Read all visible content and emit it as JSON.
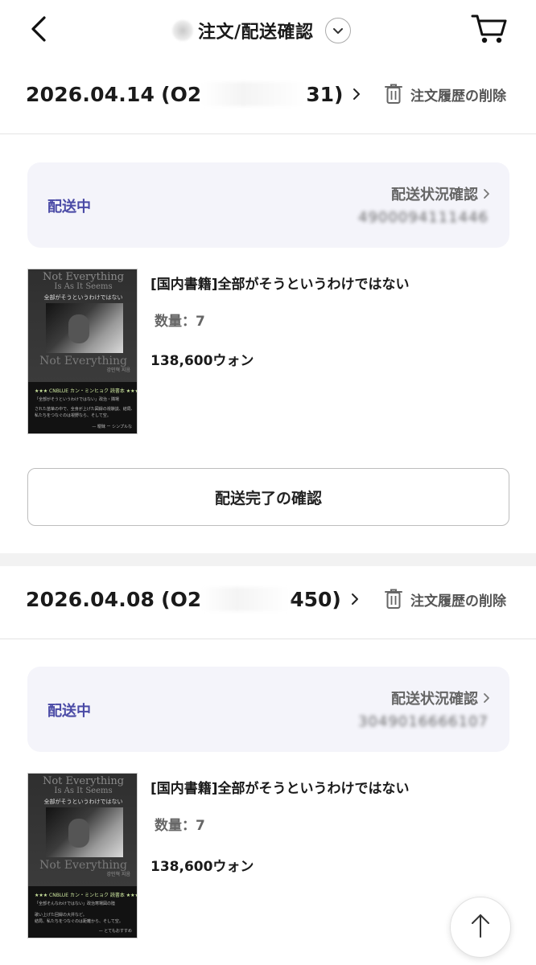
{
  "header": {
    "title": "注文/配送確認",
    "back_icon": "chevron-left-icon",
    "dropdown_icon": "chevron-down-icon",
    "cart_icon": "cart-icon"
  },
  "orders": [
    {
      "date": "2026.04.14",
      "order_no_prefix": "(O2",
      "order_no_suffix": "31)",
      "delete_label": "注文履歴の削除",
      "status": "配送中",
      "track_label": "配送状況確認",
      "tracking_no": "4900094111446",
      "product": {
        "name": "[国内書籍]全部がそうというわけではない",
        "qty": "数量：7",
        "price": "138,600ウォン",
        "cover": {
          "title_en": "Not Everything",
          "subtitle_en": "Is As It Seems",
          "title_jp": "全部がそうというわけではない",
          "author": "강민혁 지음",
          "stars": "★★★ CNBLUE カン・ミンヒョク 読書本 ★★★",
          "line1": "「全部がそうというわけではない」政治・隣場",
          "line2": "された苗箪の中で、全身が上げた図録の視験説、結局、",
          "line3": "私たちをつなぐのは視野なら、そして空。",
          "line4": "— 曖昧 ー シンプルな",
          "line5": ""
        }
      },
      "confirm_label": "配送完了の確認"
    },
    {
      "date": "2026.04.08",
      "order_no_prefix": "(O2",
      "order_no_suffix": "450)",
      "delete_label": "注文履歴の削除",
      "status": "配送中",
      "track_label": "配送状況確認",
      "tracking_no": "3049016666107",
      "product": {
        "name": "[国内書籍]全部がそうというわけではない",
        "qty": "数量：7",
        "price": "138,600ウォン",
        "cover": {
          "title_en": "Not Everything",
          "subtitle_en": "Is As It Seems",
          "title_jp": "全部がそうというわけではない",
          "author": "강민혁 지음",
          "stars": "★★★ CNBLUE カン・ミンヒョク 読書本 ★★★",
          "line1": "「全部そんなわけではない」政治寒場図の陸",
          "line2": "歌い上げた回録の大井など。",
          "line3": "結局、私たちをつなぐのは距離から、そして空。",
          "line4": "— とてもおすすめ",
          "line5": ""
        }
      }
    }
  ],
  "scroll_top_icon": "arrow-up-icon",
  "colors": {
    "status": "#4a4aa6",
    "status_bg": "#f4f4fa",
    "divider": "#e4e4e4"
  }
}
